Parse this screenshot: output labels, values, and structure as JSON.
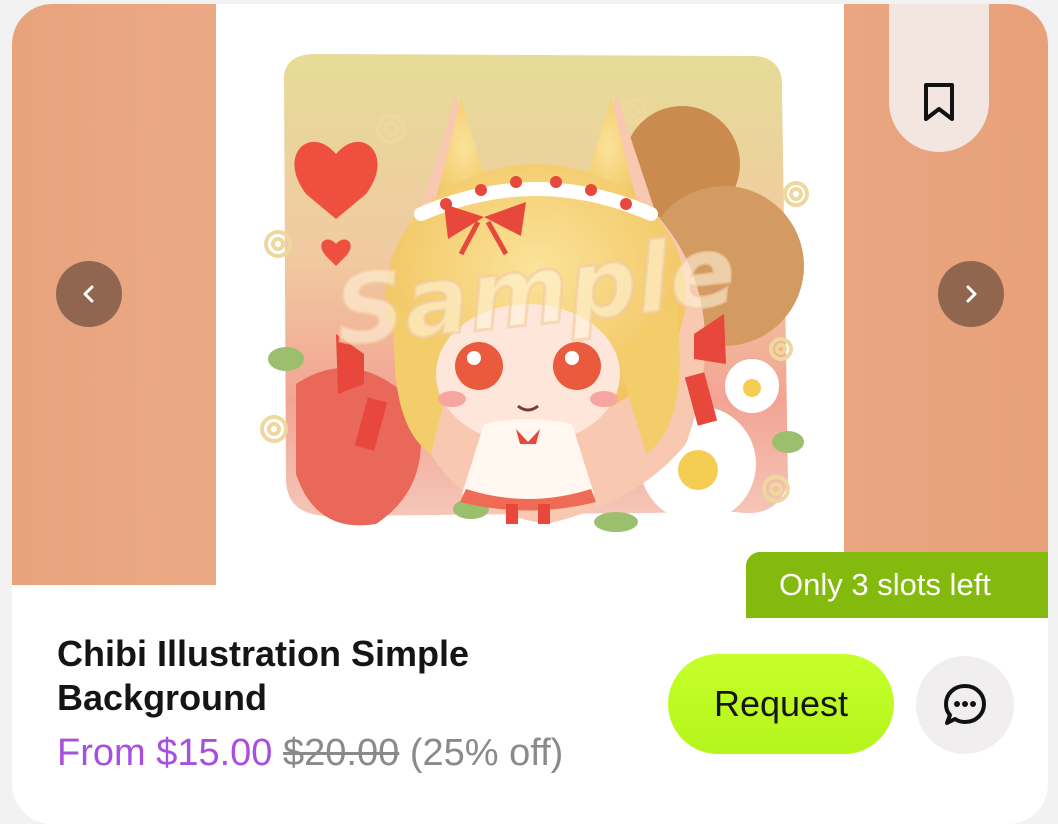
{
  "listing": {
    "title": "Chibi Illustration Simple Background",
    "price_from": "From $15.00",
    "price_original": "$20.00",
    "price_discount": "(25% off)",
    "slots_badge": "Only 3 slots left",
    "watermark": "Sample"
  },
  "actions": {
    "request_label": "Request"
  },
  "icons": {
    "prev": "chevron-left-icon",
    "next": "chevron-right-icon",
    "bookmark": "bookmark-icon",
    "chat": "chat-bubble-icon"
  },
  "colors": {
    "media_background": "#e9a680",
    "slots_badge": "#84b90e",
    "request_button": "#c6ff29",
    "price_accent": "#a64fe0",
    "muted_text": "#8a8a8a"
  }
}
